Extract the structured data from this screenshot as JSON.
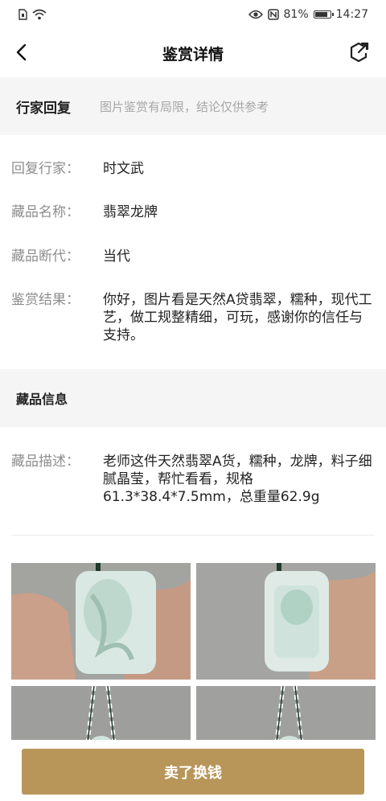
{
  "status_bar": {
    "left_icons": [
      "sim-icon",
      "wifi-icon"
    ],
    "right_icons": [
      "eye-icon",
      "nfc-icon"
    ],
    "battery_percent": "81%",
    "battery_level": 0.81,
    "time": "14:27"
  },
  "header": {
    "title": "鉴赏详情",
    "back_icon": "chevron-left-icon",
    "share_icon": "share-icon"
  },
  "reply_section": {
    "title": "行家回复",
    "note": "图片鉴赏有局限，结论仅供参考",
    "rows": [
      {
        "label": "回复行家：",
        "value": "时文武"
      },
      {
        "label": "藏品名称：",
        "value": "翡翠龙牌"
      },
      {
        "label": "藏品断代：",
        "value": "当代"
      },
      {
        "label": "鉴赏结果：",
        "value": "你好，图片看是天然A贷翡翠，糯种，现代工艺，做工规整精细，可玩，感谢你的信任与支持。"
      }
    ]
  },
  "item_section": {
    "title": "藏品信息",
    "rows": [
      {
        "label": "藏品描述：",
        "value": "老师这件天然翡翠A货，糯种，龙牌，料子细腻晶莹，帮忙看看，规格61.3*38.4*7.5mm，总重量62.9g"
      }
    ]
  },
  "photos": [
    {
      "name": "jade-photo-front"
    },
    {
      "name": "jade-photo-back"
    },
    {
      "name": "jade-photo-3"
    },
    {
      "name": "jade-photo-4"
    }
  ],
  "footer": {
    "sell_button": "卖了换钱",
    "button_color": "#b8965a"
  }
}
